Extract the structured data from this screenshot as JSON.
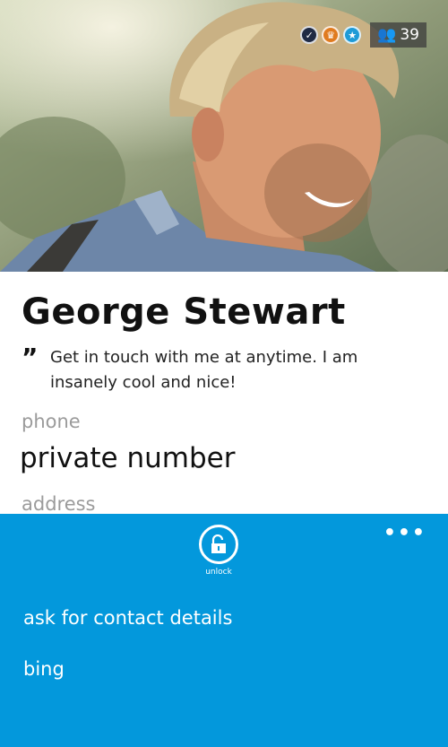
{
  "header": {
    "badges": [
      "verified-icon",
      "crown-icon",
      "star-icon"
    ],
    "friends_count": "39"
  },
  "profile": {
    "name": "George Stewart",
    "quote_mark": "”",
    "mood": "Get in touch with me at anytime. I am insanely cool and nice!",
    "phone_label": "phone",
    "phone_value": "private number",
    "address_label": "address"
  },
  "app_bar": {
    "more": "•••",
    "unlock_label": "unlock",
    "menu": [
      "ask for contact details",
      "bing"
    ]
  },
  "colors": {
    "accent": "#0398dc",
    "label_gray": "#9b9b9b"
  }
}
